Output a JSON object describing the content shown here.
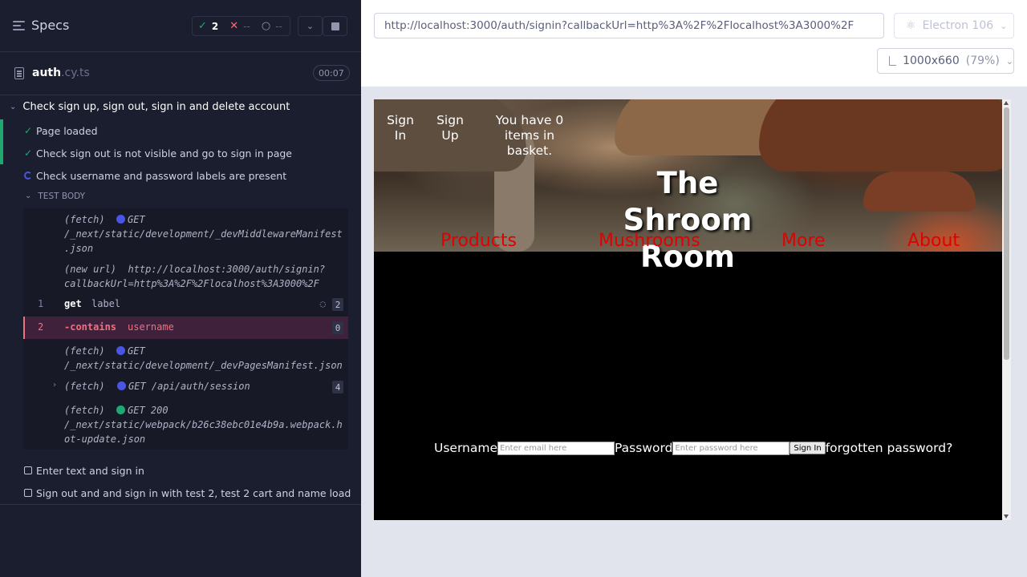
{
  "runner": {
    "specs_label": "Specs",
    "stats": {
      "passed": "2",
      "failed": "--",
      "pending": "--"
    },
    "file": {
      "name": "auth",
      "ext": ".cy.ts",
      "duration": "00:07"
    },
    "suite_title": "Check sign up, sign out, sign in and delete account",
    "tests": [
      {
        "label": "Page loaded",
        "state": "passed"
      },
      {
        "label": "Check sign out is not visible and go to sign in page",
        "state": "passed"
      },
      {
        "label": "Check username and password labels are present",
        "state": "running"
      },
      {
        "label": "Enter text and sign in",
        "state": "pending"
      },
      {
        "label": "Sign out and and sign in with test 2, test 2 cart and name load",
        "state": "pending"
      }
    ],
    "test_body_label": "TEST BODY",
    "commands": {
      "fetch1": {
        "kind": "(fetch)",
        "method": "GET",
        "path1": "/_next/static/development/_devMiddlewareManifest",
        "path2": ".json"
      },
      "newurl": {
        "kind": "(new url)",
        "url1": "http://localhost:3000/auth/signin?",
        "url2": "callbackUrl=http%3A%2F%2Flocalhost%3A3000%2F"
      },
      "get": {
        "num": "1",
        "name": "get",
        "arg": "label",
        "count": "2"
      },
      "contains": {
        "num": "2",
        "name": "-contains",
        "arg": "username",
        "count": "0"
      },
      "fetch2": {
        "kind": "(fetch)",
        "method": "GET",
        "path": "/_next/static/development/_devPagesManifest.json"
      },
      "fetch3": {
        "kind": "(fetch)",
        "text": "GET /api/auth/session",
        "count": "4"
      },
      "fetch4": {
        "kind": "(fetch)",
        "method": "GET 200",
        "path1": "/_next/static/webpack/b26c38ebc01e4b9a.webpack.h",
        "path2": "ot-update.json"
      }
    }
  },
  "aut": {
    "url": "http://localhost:3000/auth/signin?callbackUrl=http%3A%2F%2Flocalhost%3A3000%2F",
    "browser": "Electron 106",
    "viewport": "1000x660",
    "zoom": "(79%)"
  },
  "site": {
    "nav_top": {
      "signin": "Sign In",
      "signup": "Sign Up",
      "basket": "You have 0 items in basket."
    },
    "title": "The Shroom Room",
    "nav_main": [
      "Products",
      "Mushrooms",
      "More",
      "About"
    ],
    "login": {
      "username_label": "Username",
      "username_placeholder": "Enter email here",
      "password_label": "Password",
      "password_placeholder": "Enter password here",
      "signin_button": "Sign In",
      "forgot": "forgotten password?"
    }
  },
  "colors": {
    "pass": "#1fa971",
    "fail": "#f26f7e",
    "running": "#4956e3",
    "nav_link": "#e00000"
  }
}
